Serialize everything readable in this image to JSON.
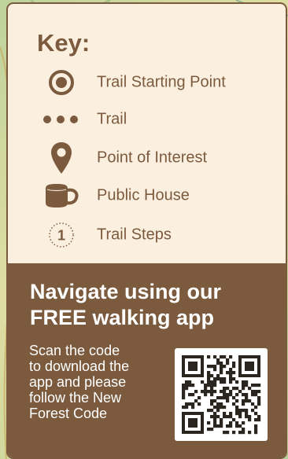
{
  "key": {
    "title": "Key:",
    "items": [
      {
        "icon": "trail-start-icon",
        "label": "Trail Starting Point"
      },
      {
        "icon": "trail-dots-icon",
        "label": "Trail"
      },
      {
        "icon": "map-pin-icon",
        "label": "Point of Interest"
      },
      {
        "icon": "mug-icon",
        "label": "Public House"
      },
      {
        "icon": "trail-step-icon",
        "label": "Trail Steps",
        "step_number": "1"
      }
    ]
  },
  "app": {
    "heading_line1": "Navigate using our",
    "heading_line2": "FREE walking app",
    "body_lines": [
      "Scan the code",
      "to download the",
      "app and please",
      "follow the New",
      "Forest Code"
    ],
    "qr_icon": "qr-code-icon"
  },
  "colors": {
    "brown": "#7b5a3e",
    "cream": "#fbf0df",
    "white": "#ffffff"
  }
}
